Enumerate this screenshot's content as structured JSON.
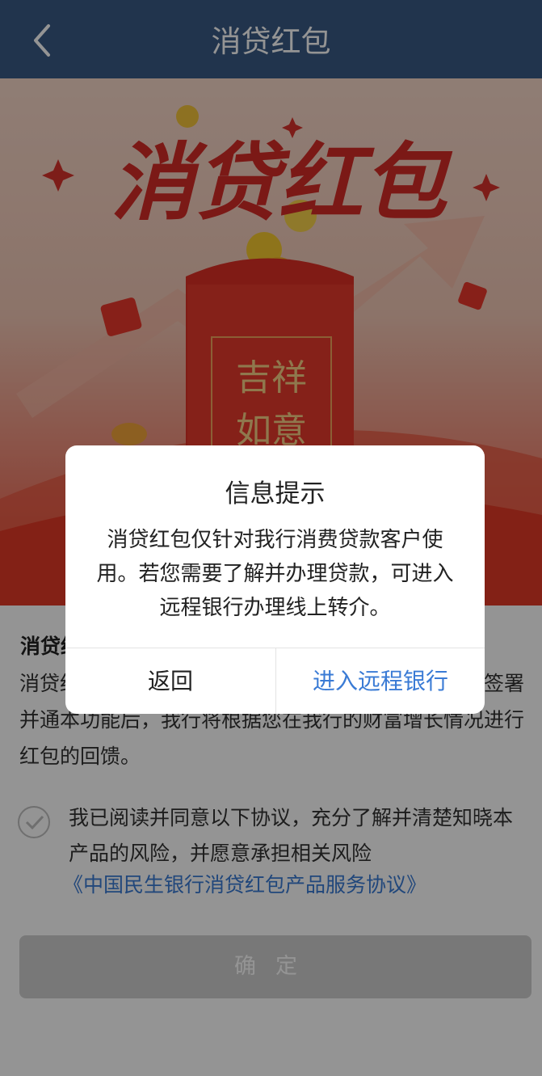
{
  "header": {
    "title": "消贷红包",
    "back_icon": "chevron-left-icon"
  },
  "banner": {
    "headline": "消贷红包",
    "envelope_text_line1": "吉祥",
    "envelope_text_line2": "如意"
  },
  "content": {
    "section_title": "消贷红包",
    "description": "消贷红包是我行为消费贷款客户提供的专属福利，您签署并通本功能后，我行将根据您在我行的财富增长情况进行红包的回馈。",
    "agreement_text": "我已阅读并同意以下协议，充分了解并清楚知晓本产品的风险，并愿意承担相关风险",
    "agreement_link": "《中国民生银行消贷红包产品服务协议》",
    "confirm_label": "确定"
  },
  "dialog": {
    "title": "信息提示",
    "message": "消贷红包仅针对我行消费贷款客户使用。若您需要了解并办理贷款，可进入远程银行办理线上转介。",
    "cancel_label": "返回",
    "confirm_label": "进入远程银行"
  },
  "colors": {
    "header_bg": "#3a5a86",
    "link_blue": "#3a7bd5",
    "banner_red": "#e0432f"
  }
}
